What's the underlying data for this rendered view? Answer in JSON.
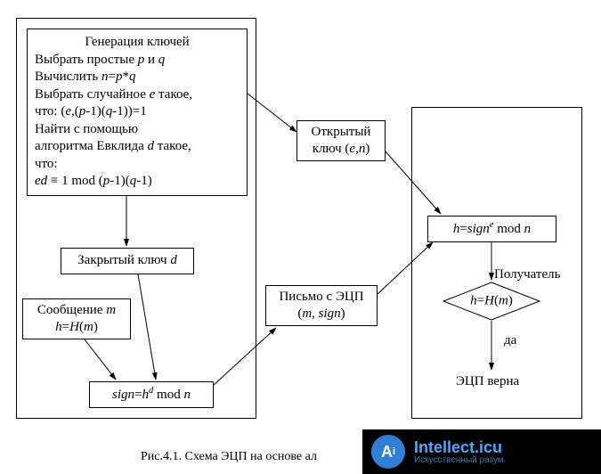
{
  "keygen": {
    "title": "Генерация ключей",
    "l1": "Выбрать простые p и q",
    "l2": "Вычислить n=p*q",
    "l3": "Выбрать случайное e такое,",
    "l4": "что: (e,(p-1)(q-1))=1",
    "l5": "Найти с помощью",
    "l6": "алгоритма Евклида d такое,",
    "l7": "что:",
    "l8": "ed ≡ 1 mod (p-1)(q-1)"
  },
  "public_key": {
    "l1": "Открытый",
    "l2": "ключ (e,n)"
  },
  "private_key": "Закрытый ключ d",
  "message": {
    "l1": "Сообщение m",
    "l2": "h=H(m)"
  },
  "sign": "sign=h^d mod n",
  "letter": {
    "l1": "Письмо с ЭЦП",
    "l2": "(m, sign)"
  },
  "verify": "h=sign^e mod n",
  "recipient": "Получатель",
  "decision": "h=H(m)",
  "yes": "да",
  "result": "ЭЦП верна",
  "caption": "Рис.4.1. Схема ЭЦП на основе ал",
  "watermark": {
    "main": "Intellect.icu",
    "sub": "Искусственный разум"
  }
}
